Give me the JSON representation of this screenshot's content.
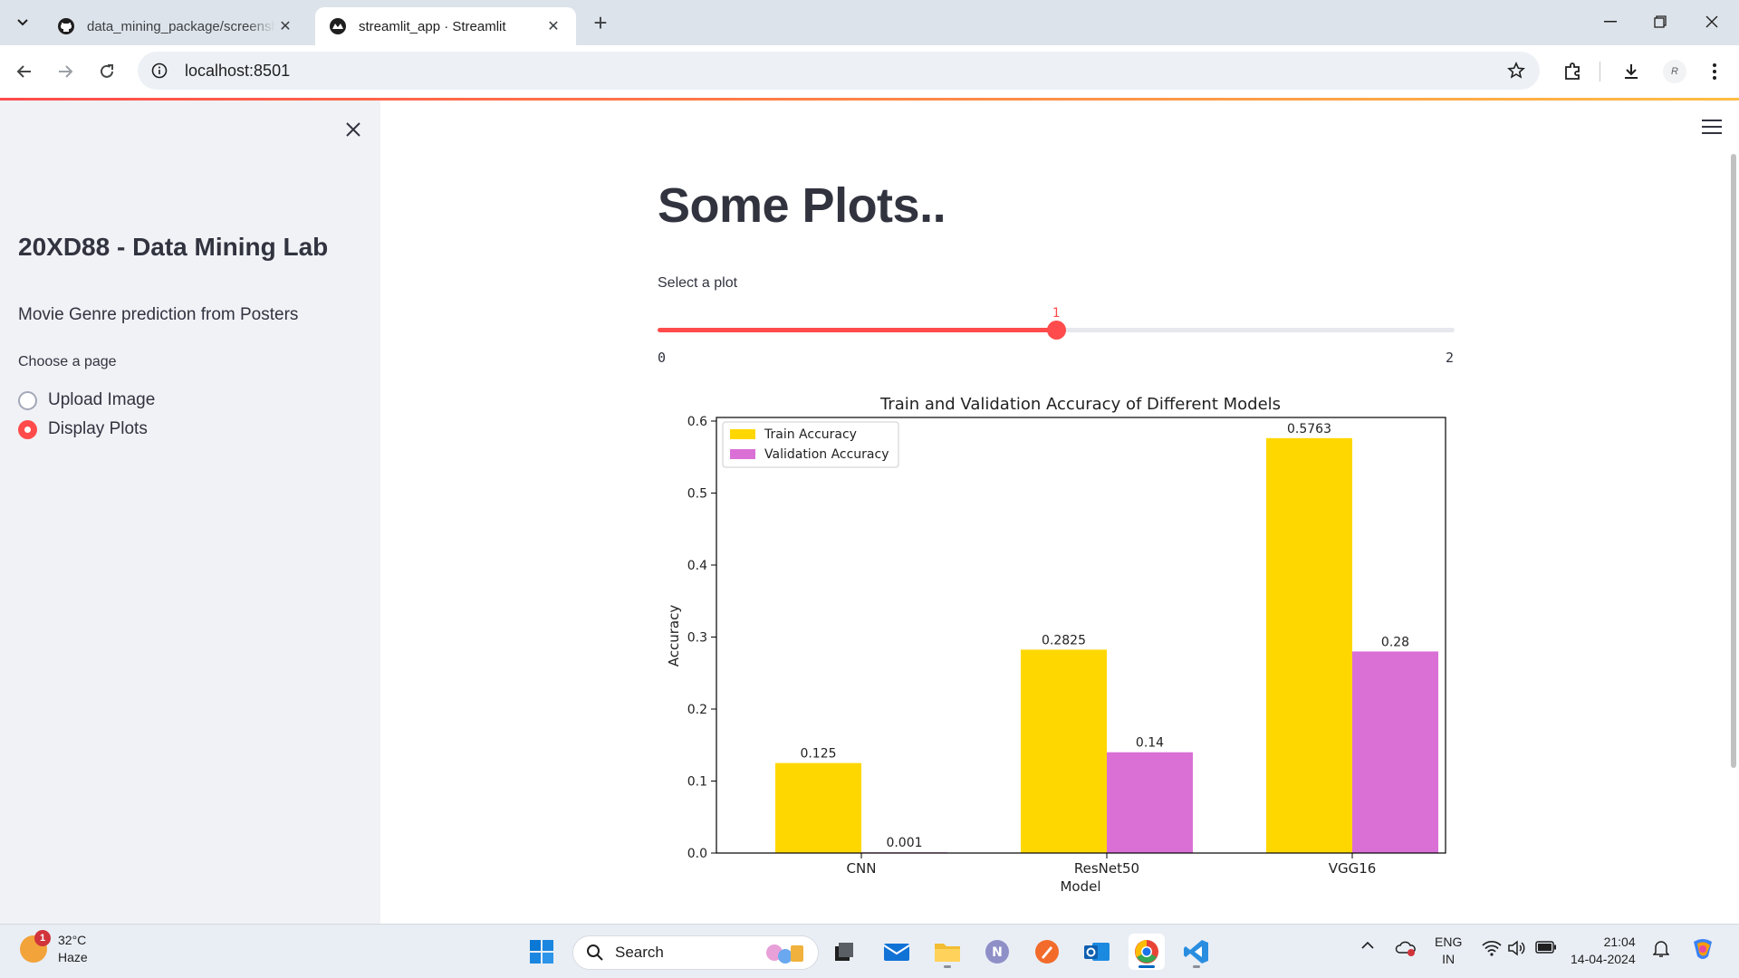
{
  "browser": {
    "tabs": [
      {
        "title": "data_mining_package/screensh",
        "active": false,
        "icon": "github-icon"
      },
      {
        "title": "streamlit_app · Streamlit",
        "active": true,
        "icon": "streamlit-icon"
      }
    ],
    "url": "localhost:8501"
  },
  "sidebar": {
    "title": "20XD88 - Data Mining Lab",
    "subtitle": "Movie Genre prediction from Posters",
    "page_label": "Choose a page",
    "options": [
      {
        "label": "Upload Image",
        "selected": false
      },
      {
        "label": "Display Plots",
        "selected": true
      }
    ]
  },
  "main": {
    "title": "Some Plots..",
    "slider": {
      "label": "Select a plot",
      "value": "1",
      "min": "0",
      "max": "2",
      "value_num": 1,
      "min_num": 0,
      "max_num": 2
    }
  },
  "chart_data": {
    "type": "bar",
    "title": "Train and Validation Accuracy of Different Models",
    "xlabel": "Model",
    "ylabel": "Accuracy",
    "categories": [
      "CNN",
      "ResNet50",
      "VGG16"
    ],
    "series": [
      {
        "name": "Train Accuracy",
        "values": [
          0.125,
          0.2825,
          0.5763
        ],
        "labels": [
          "0.125",
          "0.2825",
          "0.5763"
        ],
        "color": "#ffd700"
      },
      {
        "name": "Validation Accuracy",
        "values": [
          0.001,
          0.14,
          0.28
        ],
        "labels": [
          "0.001",
          "0.14",
          "0.28"
        ],
        "color": "#da70d6"
      }
    ],
    "ylim": [
      0,
      0.605
    ],
    "yticks": [
      "0.0",
      "0.1",
      "0.2",
      "0.3",
      "0.4",
      "0.5",
      "0.6"
    ],
    "legend": "upper-left",
    "grid": false
  },
  "taskbar": {
    "weather": {
      "temp": "32°C",
      "condition": "Haze",
      "badge": "1"
    },
    "search_placeholder": "Search",
    "lang_line1": "ENG",
    "lang_line2": "IN",
    "time": "21:04",
    "date": "14-04-2024",
    "apps": [
      "start-icon",
      "search",
      "task-view-icon",
      "mail-icon",
      "file-explorer-icon",
      "onenote-icon",
      "draw-app-icon",
      "outlook-icon",
      "chrome-icon",
      "vscode-icon"
    ]
  },
  "colors": {
    "accent": "#ff4b4b",
    "sidebar_bg": "#f0f2f6",
    "train": "#ffd700",
    "validation": "#da70d6"
  }
}
